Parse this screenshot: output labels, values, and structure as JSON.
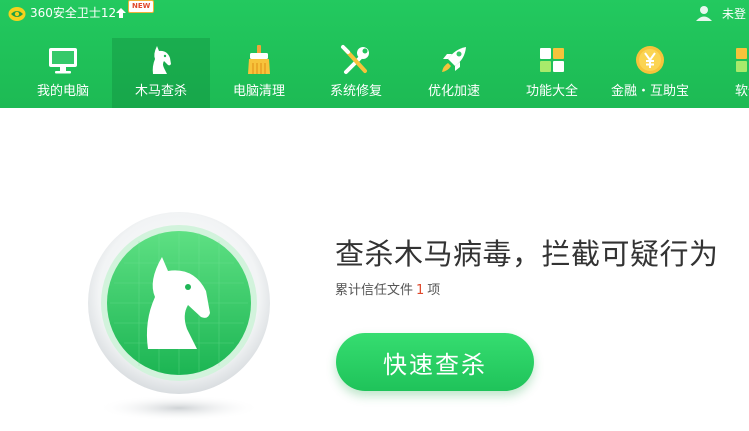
{
  "app": {
    "title": "360安全卫士12",
    "badge": "NEW",
    "login_text": "未登",
    "accent_color": "#1fc058"
  },
  "nav": {
    "items": [
      {
        "label": "我的电脑",
        "icon": "monitor-icon",
        "active": false
      },
      {
        "label": "木马查杀",
        "icon": "horse-icon",
        "active": true
      },
      {
        "label": "电脑清理",
        "icon": "broom-icon",
        "active": false
      },
      {
        "label": "系统修复",
        "icon": "wrench-screwdriver-icon",
        "active": false
      },
      {
        "label": "优化加速",
        "icon": "rocket-icon",
        "active": false
      },
      {
        "label": "功能大全",
        "icon": "grid-icon",
        "active": false
      },
      {
        "label": "金融・互助宝",
        "icon": "yuan-coin-icon",
        "active": false
      },
      {
        "label": "软件",
        "icon": "software-icon",
        "active": false
      }
    ]
  },
  "main": {
    "headline": "查杀木马病毒，拦截可疑行为",
    "trust_prefix": "累计信任文件",
    "trust_count": "1",
    "trust_suffix": "项",
    "scan_button": "快速查杀"
  }
}
